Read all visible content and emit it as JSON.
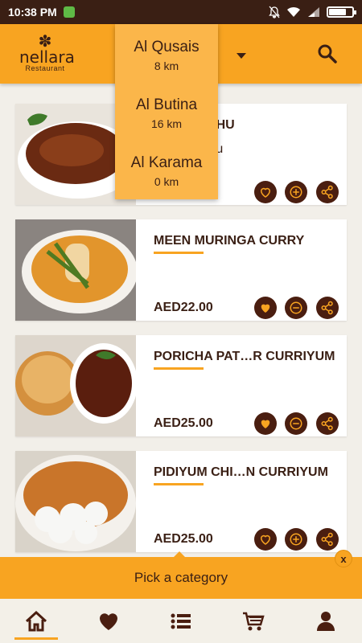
{
  "status": {
    "time": "10:38 PM",
    "battery_level": 0.75
  },
  "brand": {
    "flower": "✽",
    "name": "nellara",
    "sub": "Restaurant"
  },
  "locations": [
    {
      "name": "Al Qusais",
      "distance": "8 km"
    },
    {
      "name": "Al Butina",
      "distance": "16 km"
    },
    {
      "name": "Al Karama",
      "distance": "0 km"
    }
  ],
  "dishes": [
    {
      "title": "ATTICHATHU",
      "desc": "mulakittathu\nr)",
      "price": "",
      "favorited": false,
      "action": "add"
    },
    {
      "title": "MEEN MURINGA CURRY",
      "desc": "",
      "price": "AED22.00",
      "favorited": true,
      "action": "remove"
    },
    {
      "title": "PORICHA PAT…R CURRIYUM",
      "desc": "",
      "price": "AED25.00",
      "favorited": true,
      "action": "remove"
    },
    {
      "title": "PIDIYUM CHI…N CURRIYUM",
      "desc": "",
      "price": "AED25.00",
      "favorited": false,
      "action": "add"
    }
  ],
  "category_bar": {
    "label": "Pick a category",
    "close": "x"
  },
  "nav": [
    "home-icon",
    "heart-icon",
    "list-icon",
    "cart-icon",
    "profile-icon"
  ],
  "colors": {
    "accent": "#f8a421",
    "brown": "#3a1f14",
    "button": "#4a1e10"
  }
}
